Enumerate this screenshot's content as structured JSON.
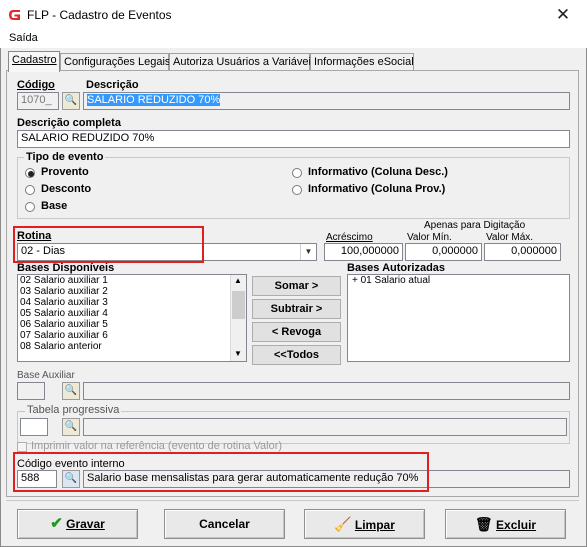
{
  "window": {
    "title": "FLP - Cadastro de Eventos"
  },
  "menu": {
    "items": [
      "Saída"
    ]
  },
  "tabs": [
    "Cadastro",
    "Configurações Legais",
    "Autoriza Usuários a Variáveis",
    "Informações eSocial"
  ],
  "form": {
    "codigo_label": "Código",
    "codigo_value": "1070_",
    "descricao_label": "Descrição",
    "descricao_value": "SALARIO REDUZIDO 70%",
    "descricao_completa_label": "Descrição completa",
    "descricao_completa_value": "SALARIO REDUZIDO 70%",
    "tipo_evento": {
      "title": "Tipo de evento",
      "options": [
        "Provento",
        "Desconto",
        "Base",
        "Informativo (Coluna Desc.)",
        "Informativo (Coluna Prov.)"
      ],
      "selected": "Provento"
    },
    "rotina_label": "Rotina",
    "rotina_value": "02 - Dias",
    "apenas_label": "Apenas para Digitação",
    "acrescimo_label": "Acréscimo",
    "acrescimo_value": "100,000000",
    "valor_min_label": "Valor Mín.",
    "valor_min_value": "0,000000",
    "valor_max_label": "Valor Máx.",
    "valor_max_value": "0,000000",
    "bases_disponiveis_label": "Bases Disponíveis",
    "bases_disponiveis": [
      "02 Salario auxiliar 1",
      "03 Salario auxiliar 2",
      "04 Salario auxiliar 3",
      "05 Salario auxiliar 4",
      "06 Salario auxiliar 5",
      "07 Salario auxiliar 6",
      "08 Salario anterior"
    ],
    "bases_autorizadas_label": "Bases Autorizadas",
    "bases_autorizadas": [
      "+ 01 Salario atual"
    ],
    "buttons": {
      "somar": "Somar >",
      "subtrair": "Subtrair >",
      "revoga": "< Revoga",
      "todos": "<<Todos"
    },
    "base_auxiliar_label": "Base Auxiliar",
    "tabela_progressiva_label": "Tabela progressiva",
    "imprimir_label": "Imprimir valor na referência (evento de rotina Valor)",
    "codigo_interno_label": "Código evento interno",
    "codigo_interno_value": "588",
    "codigo_interno_desc": "Salario base mensalistas para gerar automaticamente redução 70%"
  },
  "footer": {
    "gravar": "Gravar",
    "cancelar": "Cancelar",
    "limpar": "Limpar",
    "excluir": "Excluir"
  },
  "colors": {
    "highlight": "#e02020",
    "selection": "#3399ff",
    "brand": "#e0292b"
  }
}
